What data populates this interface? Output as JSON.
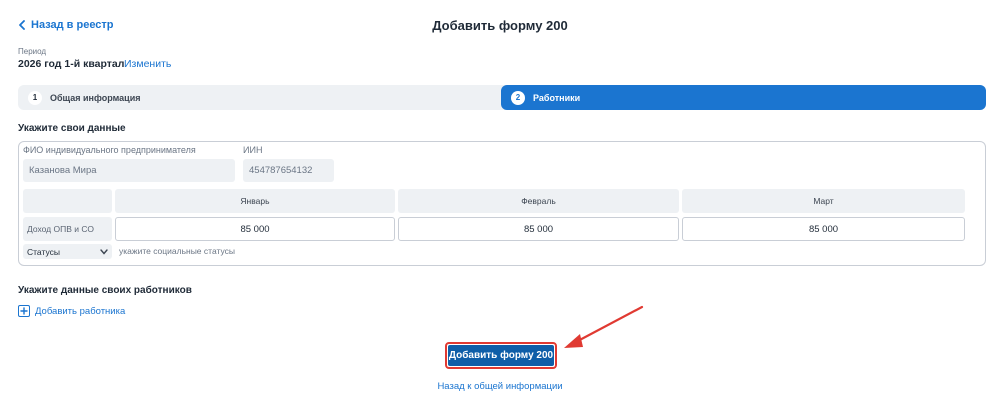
{
  "header": {
    "back_label": "Назад в реестр",
    "title": "Добавить форму 200"
  },
  "period": {
    "label": "Период",
    "value": "2026 год 1-й квартал",
    "change_label": "Изменить"
  },
  "steps": [
    {
      "number": "1",
      "label": "Общая информация",
      "active": false
    },
    {
      "number": "2",
      "label": "Работники",
      "active": true
    }
  ],
  "own_data": {
    "title": "Укажите свои данные",
    "fio_label": "ФИО индивидуального предпринимателя",
    "fio_value": "Казанова Мира",
    "iin_label": "ИИН",
    "iin_value": "454787654132",
    "months": [
      "Январь",
      "Февраль",
      "Март"
    ],
    "income_label": "Доход ОПВ и СО",
    "income_values": [
      "85 000",
      "85 000",
      "85 000"
    ],
    "status_select": "Статусы",
    "status_hint": "укажите социальные статусы"
  },
  "workers": {
    "title": "Укажите данные своих работников",
    "add_label": "Добавить работника"
  },
  "actions": {
    "submit_label": "Добавить форму 200",
    "back_general_label": "Назад к общей информации"
  },
  "colors": {
    "accent": "#1b75d0",
    "submit_bg": "#0e5ea8",
    "highlight_red": "#e03a32"
  }
}
